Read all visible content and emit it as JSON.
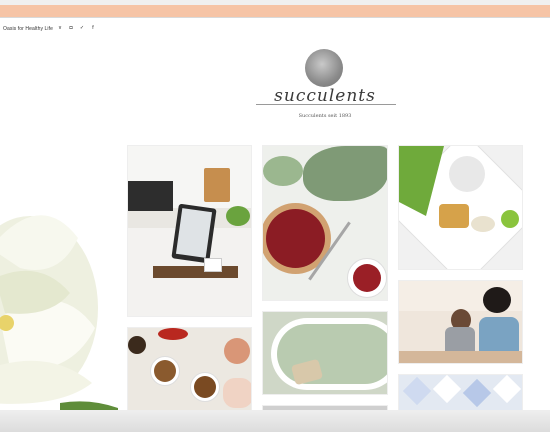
{
  "header": {
    "tagline": "Oasis for Healthy Life",
    "social_icons": [
      "vimeo-icon",
      "instagram-icon",
      "twitter-icon",
      "facebook-icon"
    ]
  },
  "logo": {
    "title": "succulents",
    "subtitle": "Succulents seit 1893"
  },
  "colors": {
    "top_bar": "#f6c4a6",
    "background": "#ffffff"
  },
  "gallery": {
    "tiles": [
      {
        "name": "kitchen-tablet-coffee-photo"
      },
      {
        "name": "cherry-tart-succulent-photo"
      },
      {
        "name": "toast-greens-tray-photo"
      },
      {
        "name": "breakfast-bowls-photo"
      },
      {
        "name": "bath-tub-photo"
      },
      {
        "name": "women-cooking-photo"
      },
      {
        "name": "blue-tiles-photo"
      }
    ]
  }
}
